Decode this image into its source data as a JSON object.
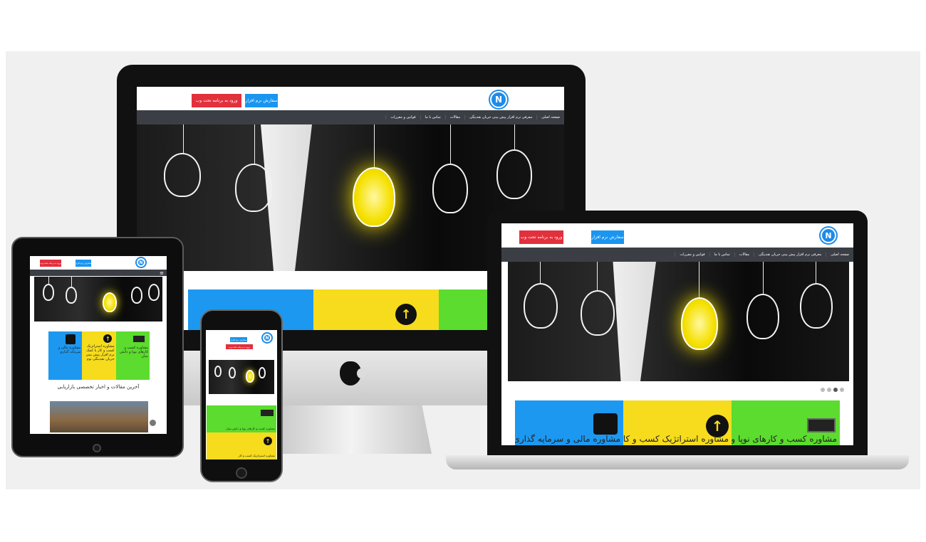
{
  "site": {
    "logo_letter": "N",
    "order_button": "سفارش نرم افزار",
    "login_button": "ورود به برنامه تحت وب",
    "nav": [
      "صفحه اصلی",
      "معرفی نرم افزار پیش بینی جریان نقدینگی",
      "مقالات",
      "تماس با ما",
      "قوانین و مقررات"
    ],
    "tiles": {
      "blue": "مشاوره مالی و سرمایه گذاری",
      "yellow": "مشاوره استراتژیک کسب و کار",
      "green": "مشاوره کسب و کارهای نوپا و"
    },
    "tablet_tiles": {
      "green": "مشاوره کسب و کارهای نوپا و دانش بنیان",
      "yellow": "مشاوره استراتژیک کسب و کار با کمک نرم افزار پیش بینی جریان نقدینگی نوم",
      "blue": "مشاوره مالی و سرمایه گذاری"
    },
    "tablet_heading": "آخرین مقالات و اخبار تخصصی بازاریابی",
    "phone_tiles": {
      "green": "مشاوره کسب و کارهای نوپا و دانش بنیان",
      "yellow": "مشاوره استراتژیک کسب و کار"
    }
  },
  "colors": {
    "accent_blue": "#1d98f0",
    "accent_red": "#e2303d",
    "tile_yellow": "#f6dc1c",
    "tile_green": "#5bdc2e",
    "nav_bg": "#3b3f45"
  },
  "icons": [
    "logo-icon",
    "puzzle-icon",
    "arrow-up-icon",
    "money-icon",
    "apple-logo-icon",
    "menu-icon"
  ]
}
